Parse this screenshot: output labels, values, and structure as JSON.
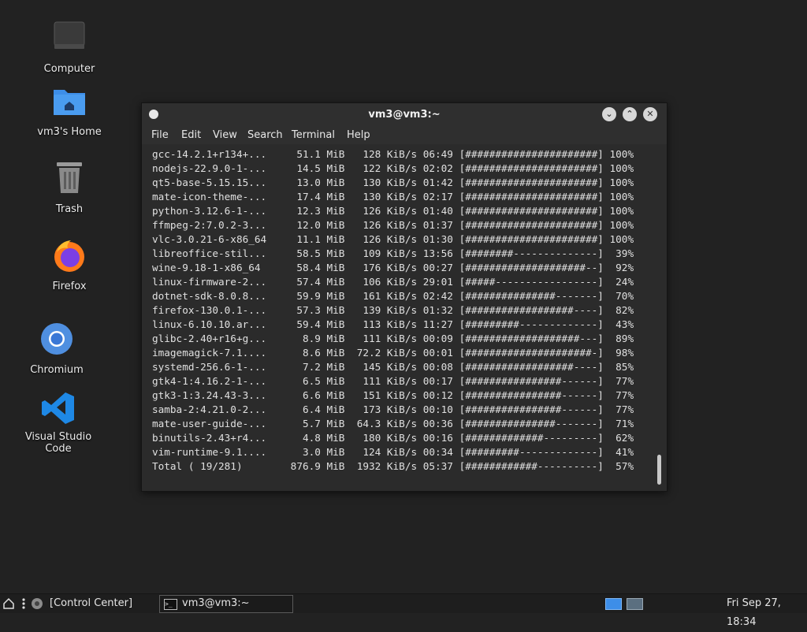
{
  "desktop": {
    "icons": [
      {
        "label": "Computer"
      },
      {
        "label": "vm3's Home"
      },
      {
        "label": "Trash"
      },
      {
        "label": "Firefox"
      },
      {
        "label": "Chromium"
      },
      {
        "label": "Visual Studio Code"
      }
    ]
  },
  "window": {
    "title": "vm3@vm3:~",
    "menu": [
      "File",
      "Edit",
      "View",
      "Search",
      "Terminal",
      "Help"
    ],
    "lines": [
      "gcc-14.2.1+r134+...     51.1 MiB   128 KiB/s 06:49 [######################] 100%",
      "nodejs-22.9.0-1-...     14.5 MiB   122 KiB/s 02:02 [######################] 100%",
      "qt5-base-5.15.15...     13.0 MiB   130 KiB/s 01:42 [######################] 100%",
      "mate-icon-theme-...     17.4 MiB   130 KiB/s 02:17 [######################] 100%",
      "python-3.12.6-1-...     12.3 MiB   126 KiB/s 01:40 [######################] 100%",
      "ffmpeg-2:7.0.2-3...     12.0 MiB   126 KiB/s 01:37 [######################] 100%",
      "vlc-3.0.21-6-x86_64     11.1 MiB   126 KiB/s 01:30 [######################] 100%",
      "libreoffice-stil...     58.5 MiB   109 KiB/s 13:56 [########--------------]  39%",
      "wine-9.18-1-x86_64      58.4 MiB   176 KiB/s 00:27 [####################--]  92%",
      "linux-firmware-2...     57.4 MiB   106 KiB/s 29:01 [#####-----------------]  24%",
      "dotnet-sdk-8.0.8...     59.9 MiB   161 KiB/s 02:42 [###############-------]  70%",
      "firefox-130.0.1-...     57.3 MiB   139 KiB/s 01:32 [##################----]  82%",
      "linux-6.10.10.ar...     59.4 MiB   113 KiB/s 11:27 [#########-------------]  43%",
      "glibc-2.40+r16+g...      8.9 MiB   111 KiB/s 00:09 [###################---]  89%",
      "imagemagick-7.1....      8.6 MiB  72.2 KiB/s 00:01 [#####################-]  98%",
      "systemd-256.6-1-...      7.2 MiB   145 KiB/s 00:08 [##################----]  85%",
      "gtk4-1:4.16.2-1-...      6.5 MiB   111 KiB/s 00:17 [################------]  77%",
      "gtk3-1:3.24.43-3...      6.6 MiB   151 KiB/s 00:12 [################------]  77%",
      "samba-2:4.21.0-2...      6.4 MiB   173 KiB/s 00:10 [################------]  77%",
      "mate-user-guide-...      5.7 MiB  64.3 KiB/s 00:36 [###############-------]  71%",
      "binutils-2.43+r4...      4.8 MiB   180 KiB/s 00:16 [#############---------]  62%",
      "vim-runtime-9.1....      3.0 MiB   124 KiB/s 00:34 [#########-------------]  41%",
      "Total ( 19/281)        876.9 MiB  1932 KiB/s 05:37 [############----------]  57%"
    ]
  },
  "panel": {
    "control_center": "[Control Center]",
    "task_label": "vm3@vm3:~",
    "clock": "Fri Sep 27, 18:34"
  },
  "colors": {
    "desktop_bg": "#222222",
    "folder_blue": "#3d8ee8",
    "vscode_blue": "#1e88e5",
    "workspace_active": "#3d8ee8"
  }
}
